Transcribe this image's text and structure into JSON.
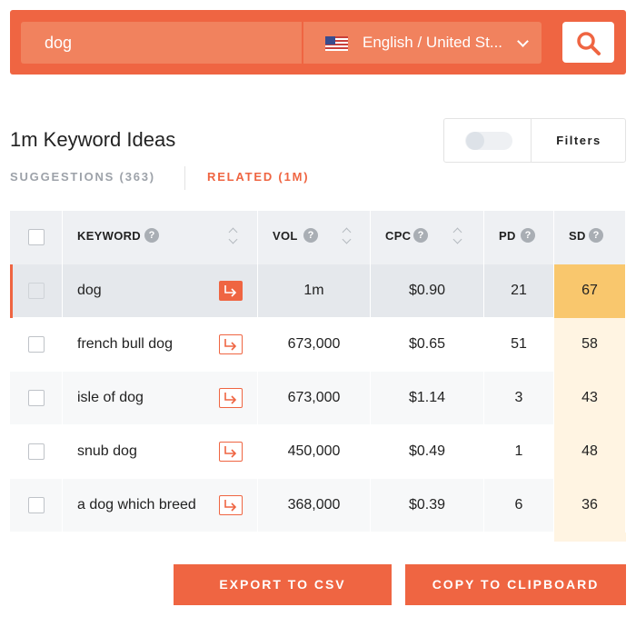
{
  "search": {
    "query": "dog",
    "language": "English / United St..."
  },
  "heading": {
    "title": "1m Keyword Ideas",
    "filters_label": "Filters"
  },
  "tabs": {
    "suggestions": "SUGGESTIONS (363)",
    "related": "RELATED (1M)",
    "active": "related"
  },
  "table": {
    "headers": {
      "keyword": "KEYWORD",
      "vol": "VOL",
      "cpc": "CPC",
      "pd": "PD",
      "sd": "SD"
    },
    "rows": [
      {
        "keyword": "dog",
        "vol": "1m",
        "cpc": "$0.90",
        "pd": "21",
        "sd": "67",
        "selected": true
      },
      {
        "keyword": "french bull dog",
        "vol": "673,000",
        "cpc": "$0.65",
        "pd": "51",
        "sd": "58"
      },
      {
        "keyword": "isle of dog",
        "vol": "673,000",
        "cpc": "$1.14",
        "pd": "3",
        "sd": "43"
      },
      {
        "keyword": "snub dog",
        "vol": "450,000",
        "cpc": "$0.49",
        "pd": "1",
        "sd": "48"
      },
      {
        "keyword": "a dog which breed",
        "vol": "368,000",
        "cpc": "$0.39",
        "pd": "6",
        "sd": "36"
      }
    ]
  },
  "actions": {
    "export": "EXPORT TO CSV",
    "copy": "COPY TO CLIPBOARD"
  },
  "colors": {
    "accent": "#ef6542",
    "sd_high": "#f9c76d",
    "sd_low": "#fff4e2"
  }
}
